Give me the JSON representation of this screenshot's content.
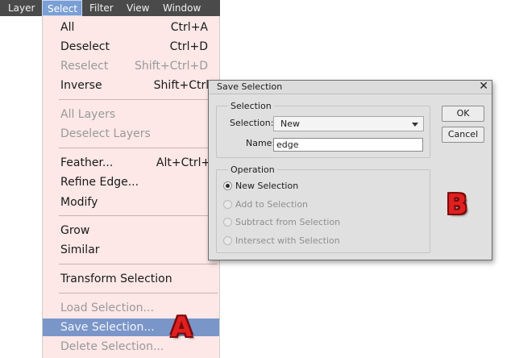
{
  "menubar": {
    "items": [
      "Layer",
      "Select",
      "Filter",
      "View",
      "Window"
    ],
    "active": "Select"
  },
  "select_menu": {
    "items": [
      {
        "label": "All",
        "shortcut": "Ctrl+A",
        "disabled": false
      },
      {
        "label": "Deselect",
        "shortcut": "Ctrl+D",
        "disabled": false
      },
      {
        "label": "Reselect",
        "shortcut": "Shift+Ctrl+D",
        "disabled": true
      },
      {
        "label": "Inverse",
        "shortcut": "Shift+Ctrl+I",
        "disabled": false
      },
      {
        "label": "All Layers",
        "shortcut": "",
        "disabled": true
      },
      {
        "label": "Deselect Layers",
        "shortcut": "",
        "disabled": true
      },
      {
        "label": "Feather...",
        "shortcut": "Alt+Ctrl+D",
        "disabled": false
      },
      {
        "label": "Refine Edge...",
        "shortcut": "",
        "disabled": false
      },
      {
        "label": "Modify",
        "shortcut": "",
        "disabled": false
      },
      {
        "label": "Grow",
        "shortcut": "",
        "disabled": false
      },
      {
        "label": "Similar",
        "shortcut": "",
        "disabled": false
      },
      {
        "label": "Transform Selection",
        "shortcut": "",
        "disabled": false
      },
      {
        "label": "Load Selection...",
        "shortcut": "",
        "disabled": true
      },
      {
        "label": "Save Selection...",
        "shortcut": "",
        "disabled": false,
        "highlighted": true
      },
      {
        "label": "Delete Selection...",
        "shortcut": "",
        "disabled": true
      }
    ]
  },
  "dialog": {
    "title": "Save Selection",
    "close_glyph": "✕",
    "selection_group": {
      "title": "Selection",
      "selection_label": "Selection:",
      "selection_value": "New",
      "name_label": "Name:",
      "name_value": "edge"
    },
    "operation_group": {
      "title": "Operation",
      "options": [
        {
          "label": "New Selection",
          "checked": true,
          "disabled": false
        },
        {
          "label": "Add to Selection",
          "checked": false,
          "disabled": true
        },
        {
          "label": "Subtract from Selection",
          "checked": false,
          "disabled": true
        },
        {
          "label": "Intersect with Selection",
          "checked": false,
          "disabled": true
        }
      ]
    },
    "ok_label": "OK",
    "cancel_label": "Cancel"
  },
  "annotations": {
    "a": "A",
    "b": "B",
    "color": "#e02020"
  },
  "colors": {
    "menubar": "#4a4a4a",
    "menu_bg": "#fde7e7",
    "highlight": "#7a96c9",
    "dialog_bg": "#e0e0e0"
  }
}
